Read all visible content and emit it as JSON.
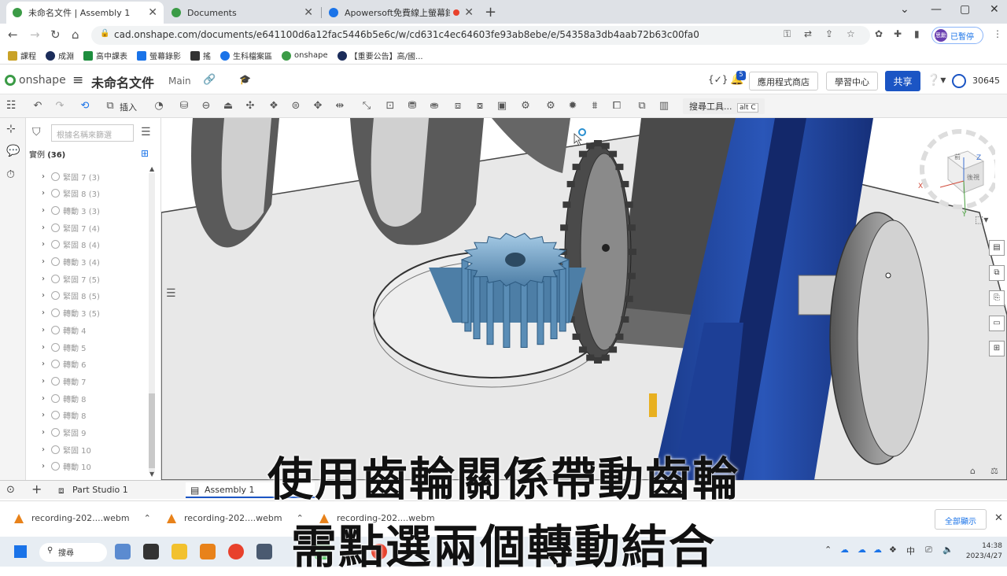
{
  "browser": {
    "tabs": [
      {
        "title": "未命名文件 | Assembly 1",
        "active": true
      },
      {
        "title": "Documents",
        "active": false
      },
      {
        "title": "Apowersoft免費線上螢幕錄",
        "active": false
      }
    ],
    "url": "cad.onshape.com/documents/e641100d6a12fac5446b5e6c/w/cd631c4ec64603fe93ab8ebe/e/54358a3db4aab72b63c00fa0",
    "profile_label": "已暫停",
    "profile_initial": "思勳"
  },
  "bookmarks": [
    {
      "label": "課程",
      "color": "#c9a227"
    },
    {
      "label": "成淵",
      "color": "#1b2c5a"
    },
    {
      "label": "高中課表",
      "color": "#1e8e3e"
    },
    {
      "label": "螢幕錄影",
      "color": "#1a73e8"
    },
    {
      "label": "搖",
      "color": "#333333"
    },
    {
      "label": "生科檔案區",
      "color": "#1a73e8"
    },
    {
      "label": "onshape",
      "color": "#3b9b46"
    },
    {
      "label": "【重要公告】高/國...",
      "color": "#1b2c5a"
    }
  ],
  "onshape": {
    "logo": "onshape",
    "doc_title": "未命名文件",
    "branch": "Main",
    "notifications": "5",
    "app_store": "應用程式商店",
    "learning": "學習中心",
    "share": "共享",
    "user": "30645",
    "insert_label": "插入",
    "search_tools": "搜尋工具...",
    "search_shortcut": "alt C"
  },
  "feature_list": {
    "filter_placeholder": "根據名稱來篩選",
    "title": "實例",
    "count": "(36)",
    "items": [
      "緊固 7 (3)",
      "緊固 8 (3)",
      "轉動 3 (3)",
      "緊固 7 (4)",
      "緊固 8 (4)",
      "轉動 3 (4)",
      "緊固 7 (5)",
      "緊固 8 (5)",
      "轉動 3 (5)",
      "轉動 4",
      "轉動 5",
      "轉動 6",
      "轉動 7",
      "轉動 8",
      "轉動 8",
      "緊固 9",
      "緊固 10",
      "轉動 10"
    ]
  },
  "bottom_tabs": [
    "Part Studio 1",
    "Assembly 1"
  ],
  "downloads": [
    "recording-202....webm",
    "recording-202....webm",
    "recording-202....webm"
  ],
  "downloads_show_all": "全部顯示",
  "taskbar": {
    "search": "搜尋",
    "ime": "中",
    "time": "14:38",
    "date": "2023/4/27"
  },
  "subtitles": [
    "使用齒輪關係帶動齒輪",
    "需點選兩個轉動結合"
  ],
  "viewcube": {
    "top_label": "前",
    "side_label": "後視",
    "axes": [
      "X",
      "Y",
      "Z"
    ]
  }
}
